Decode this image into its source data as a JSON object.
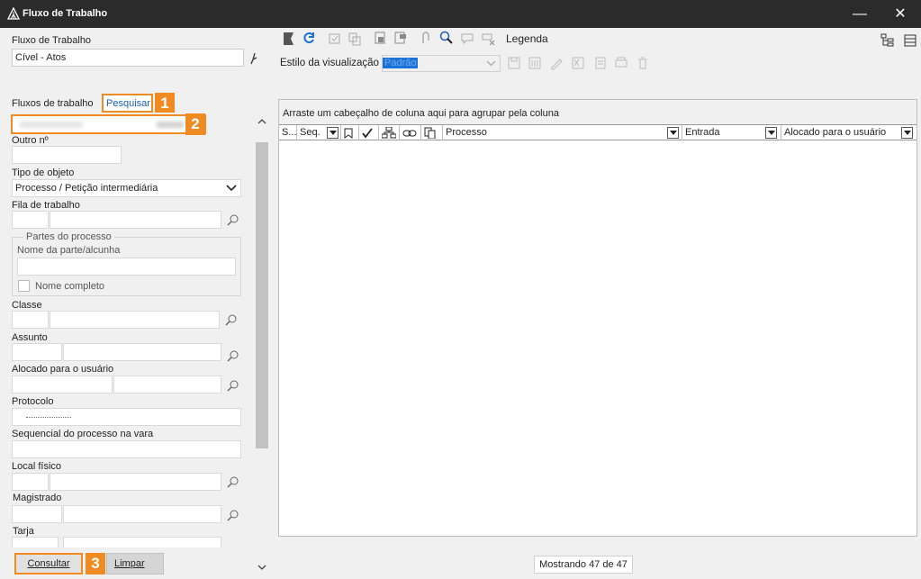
{
  "window": {
    "title": "Fluxo de Trabalho",
    "minimize": "—",
    "close": "✕"
  },
  "left": {
    "workflow_label": "Fluxo de Trabalho",
    "workflow_value": "Cível - Atos",
    "tabs": [
      "Fluxos de trabalho",
      "Pesquisar"
    ],
    "fields": {
      "outro_label": "Outro nº",
      "tipo_label": "Tipo de objeto",
      "tipo_value": "Processo / Petição intermediária",
      "fila_label": "Fila de trabalho",
      "partes_group": "Partes do processo",
      "nome_parte_placeholder": "Nome da parte/alcunha",
      "nome_completo": "Nome completo",
      "classe_label": "Classe",
      "assunto_label": "Assunto",
      "alocado_label": "Alocado para o usuário",
      "protocolo_label": "Protocolo",
      "sequencial_label": "Sequencial do processo na vara",
      "local_label": "Local físico",
      "magistrado_label": "Magistrado",
      "tarja_label": "Tarja"
    },
    "buttons": {
      "consultar": "Consultar",
      "limpar": "Limpar"
    },
    "badges": [
      "1",
      "2",
      "3"
    ]
  },
  "toolbar": {
    "legenda": "Legenda",
    "estilo_label": "Estilo da visualização",
    "estilo_value": "Padrão"
  },
  "grid": {
    "group_hint": "Arraste um cabeçalho de coluna aqui para agrupar pela coluna",
    "columns": [
      "S...",
      "Seq.",
      "Processo",
      "Entrada",
      "Alocado para o usuário"
    ],
    "status": "Mostrando 47 de 47"
  },
  "colors": {
    "accent": "#f08b24",
    "titlebar": "#2b2b2b",
    "link": "#1a5fb4"
  }
}
